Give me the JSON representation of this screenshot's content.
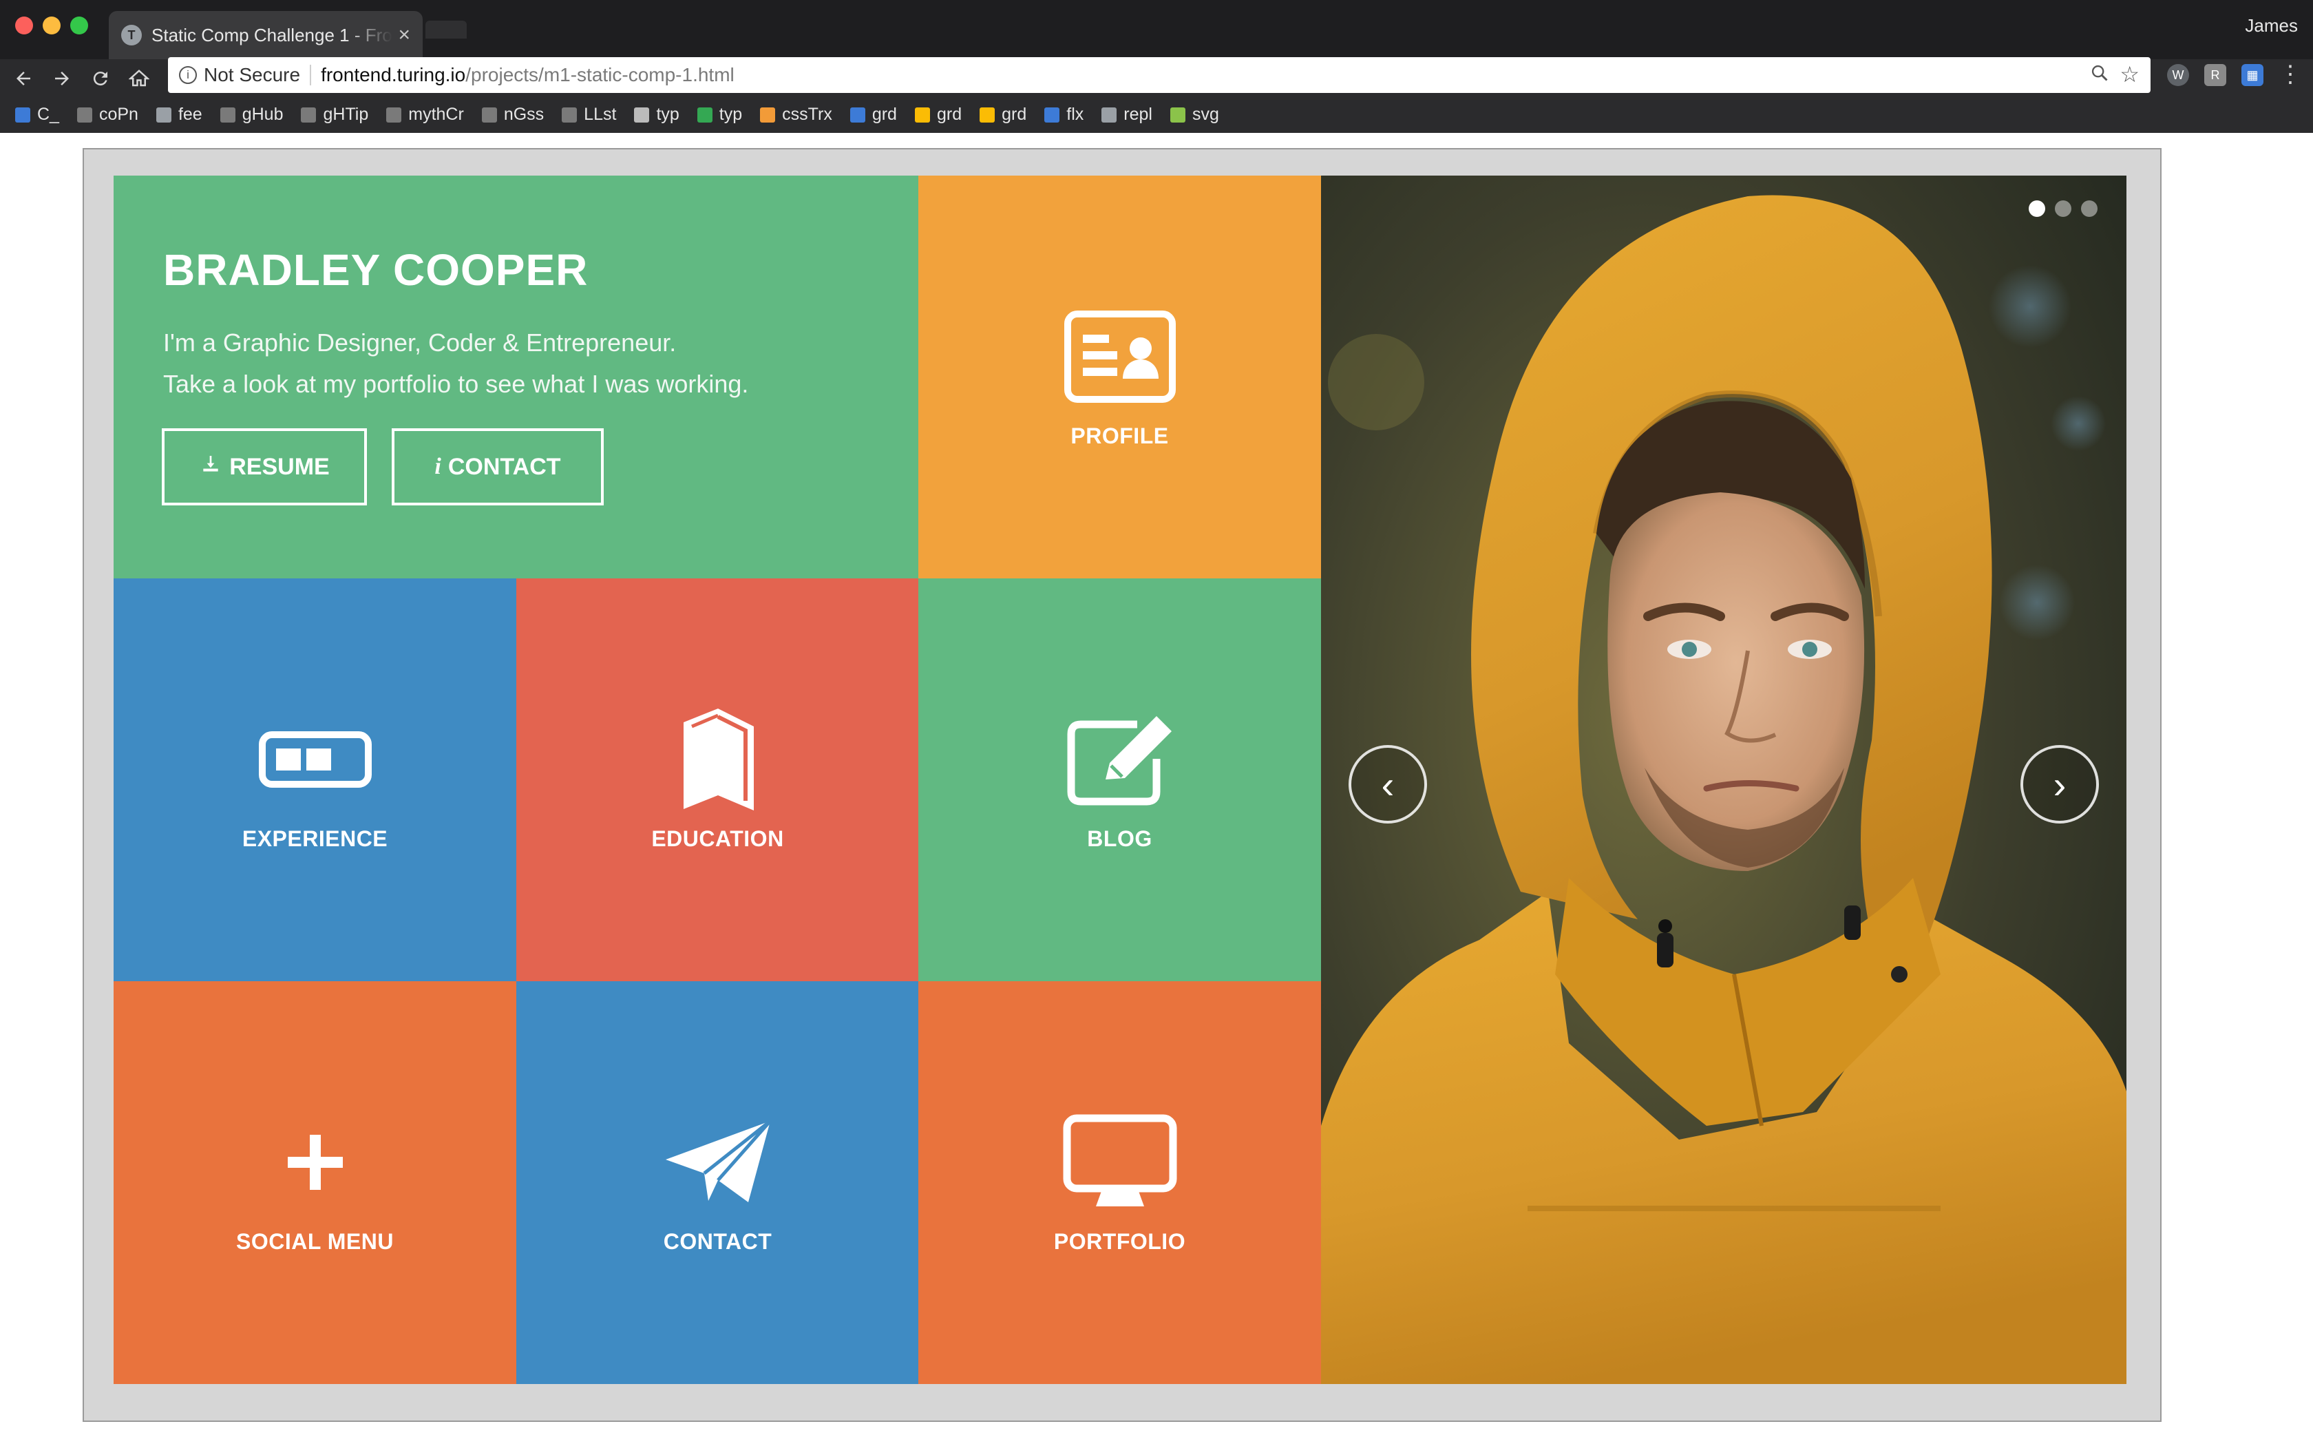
{
  "browser": {
    "tab_title": "Static Comp Challenge 1 - Fron",
    "tab_close": "×",
    "profile_name": "James",
    "security_label": "Not Secure",
    "url_host": "frontend.turing.io",
    "url_path": "/projects/m1-static-comp-1.html",
    "bookmarks": [
      {
        "label": "C_"
      },
      {
        "label": "coPn"
      },
      {
        "label": "fee"
      },
      {
        "label": "gHub"
      },
      {
        "label": "gHTip"
      },
      {
        "label": "mythCr"
      },
      {
        "label": "nGss"
      },
      {
        "label": "LLst"
      },
      {
        "label": "typ"
      },
      {
        "label": "typ"
      },
      {
        "label": "cssTrx"
      },
      {
        "label": "grd"
      },
      {
        "label": "grd"
      },
      {
        "label": "grd"
      },
      {
        "label": "flx"
      },
      {
        "label": "repl"
      },
      {
        "label": "svg"
      }
    ]
  },
  "hero": {
    "name": "BRADLEY COOPER",
    "tagline_1": "I'm a Graphic Designer, Coder & Entrepreneur.",
    "tagline_2": "Take a look at my portfolio to see what I was working.",
    "resume_label": "RESUME",
    "contact_label": "CONTACT",
    "contact_glyph": "i"
  },
  "tiles": {
    "profile": "PROFILE",
    "experience": "EXPERIENCE",
    "education": "EDUCATION",
    "blog": "BLOG",
    "social_menu": "SOCIAL MENU",
    "contact": "CONTACT",
    "portfolio": "PORTFOLIO"
  },
  "carousel": {
    "prev": "‹",
    "next": "›",
    "active_slide": 1,
    "slide_count": 3
  },
  "colors": {
    "green": "#61b982",
    "yellow_orange": "#f2a23c",
    "blue": "#3f8bc3",
    "red": "#e36450",
    "orange": "#e9733d",
    "frame": "#d6d6d6"
  }
}
